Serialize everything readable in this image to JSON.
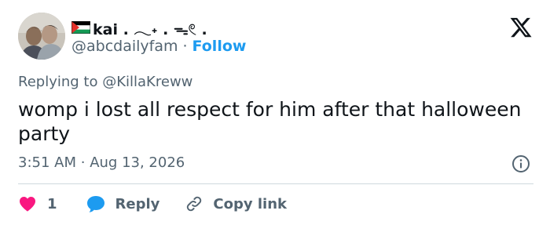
{
  "user": {
    "display_name": "kai . 𓂃˖ . ᯓ𓏲 .",
    "handle": "@abcdailyfam",
    "separator": "·",
    "follow_label": "Follow",
    "flag_icon": "palestine-flag-icon",
    "avatar_icon": "profile-photo-avatar"
  },
  "reply_context": {
    "prefix": "Replying to",
    "mention": "@KillaKreww"
  },
  "tweet": {
    "text": "womp i lost all respect for him after that halloween party",
    "time": "3:51 AM",
    "separator": "·",
    "date": "Aug 13, 2026"
  },
  "actions": {
    "like_count": "1",
    "reply_label": "Reply",
    "copy_link_label": "Copy link"
  },
  "icons": {
    "brand": "x-logo-icon",
    "info": "info-icon",
    "like": "heart-icon",
    "reply": "speech-bubble-icon",
    "copy": "link-icon"
  },
  "colors": {
    "like": "#f91880",
    "reply": "#1d9bf0",
    "follow": "#1d9bf0",
    "secondary_text": "#536471",
    "primary_text": "#0f1419"
  }
}
